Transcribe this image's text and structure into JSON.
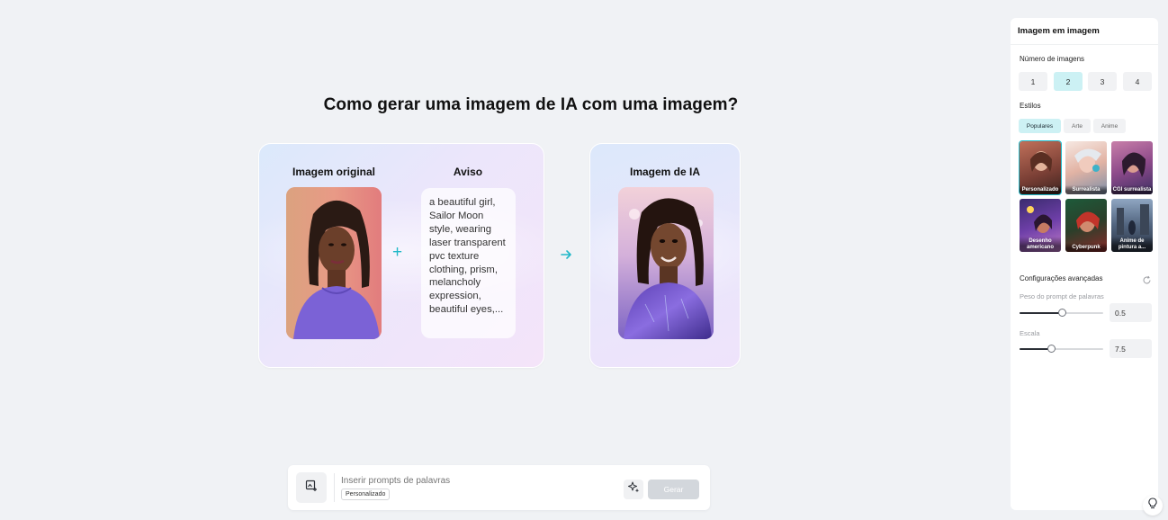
{
  "main": {
    "title": "Como gerar uma imagem de IA com uma imagem?",
    "original_label": "Imagem original",
    "prompt_label": "Aviso",
    "ai_label": "Imagem de IA",
    "prompt_text": "a beautiful girl, Sailor Moon style, wearing laser transparent pvc texture clothing, prism, melancholy expression, beautiful eyes,...",
    "plus_icon": "plus-icon",
    "arrow_icon": "arrow-right-icon",
    "accent_color": "#20b8c8"
  },
  "bottom_bar": {
    "prompt_placeholder": "Inserir prompts de palavras",
    "custom_tag": "Personalizado",
    "generate_label": "Gerar",
    "upload_icon": "image-upload-icon",
    "magic_icon": "sparkle-icon"
  },
  "panel": {
    "title": "Imagem em imagem",
    "num_images_label": "Número de imagens",
    "num_options": [
      "1",
      "2",
      "3",
      "4"
    ],
    "num_selected": "2",
    "styles_label": "Estilos",
    "style_tabs": [
      "Populares",
      "Arte",
      "Anime"
    ],
    "style_tab_selected": "Populares",
    "styles": [
      {
        "label": "Personalizado",
        "selected": true
      },
      {
        "label": "Surrealista",
        "selected": false
      },
      {
        "label": "CGI surrealista",
        "selected": false
      },
      {
        "label": "Desenho americano",
        "selected": false
      },
      {
        "label": "Cyberpunk",
        "selected": false
      },
      {
        "label": "Anime de pintura a...",
        "selected": false
      }
    ],
    "advanced_label": "Configurações avançadas",
    "reset_icon": "reset-icon",
    "weight_label": "Peso do prompt de palavras",
    "weight_value": "0.5",
    "weight_fraction": 0.5,
    "scale_label": "Escala",
    "scale_value": "7.5",
    "scale_fraction": 0.375
  },
  "help_icon": "lightbulb-icon"
}
